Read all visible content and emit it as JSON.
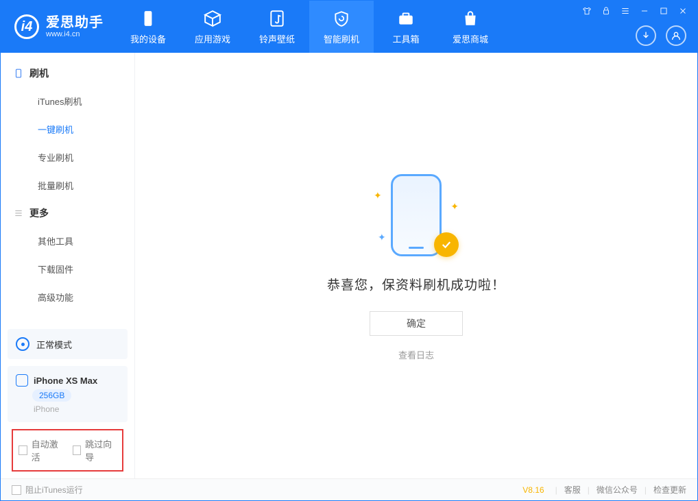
{
  "app": {
    "title": "爱思助手",
    "subtitle": "www.i4.cn"
  },
  "nav": {
    "items": [
      {
        "label": "我的设备"
      },
      {
        "label": "应用游戏"
      },
      {
        "label": "铃声壁纸"
      },
      {
        "label": "智能刷机"
      },
      {
        "label": "工具箱"
      },
      {
        "label": "爱思商城"
      }
    ]
  },
  "sidebar": {
    "group1": {
      "title": "刷机",
      "items": [
        {
          "label": "iTunes刷机"
        },
        {
          "label": "一键刷机"
        },
        {
          "label": "专业刷机"
        },
        {
          "label": "批量刷机"
        }
      ]
    },
    "group2": {
      "title": "更多",
      "items": [
        {
          "label": "其他工具"
        },
        {
          "label": "下载固件"
        },
        {
          "label": "高级功能"
        }
      ]
    },
    "mode": "正常模式",
    "device": {
      "name": "iPhone XS Max",
      "storage": "256GB",
      "type": "iPhone"
    },
    "options": {
      "auto_activate": "自动激活",
      "skip_guide": "跳过向导"
    }
  },
  "main": {
    "success_text": "恭喜您，保资料刷机成功啦！",
    "ok_label": "确定",
    "log_link": "查看日志"
  },
  "footer": {
    "block_itunes": "阻止iTunes运行",
    "version": "V8.16",
    "links": {
      "kefu": "客服",
      "wechat": "微信公众号",
      "update": "检查更新"
    }
  }
}
